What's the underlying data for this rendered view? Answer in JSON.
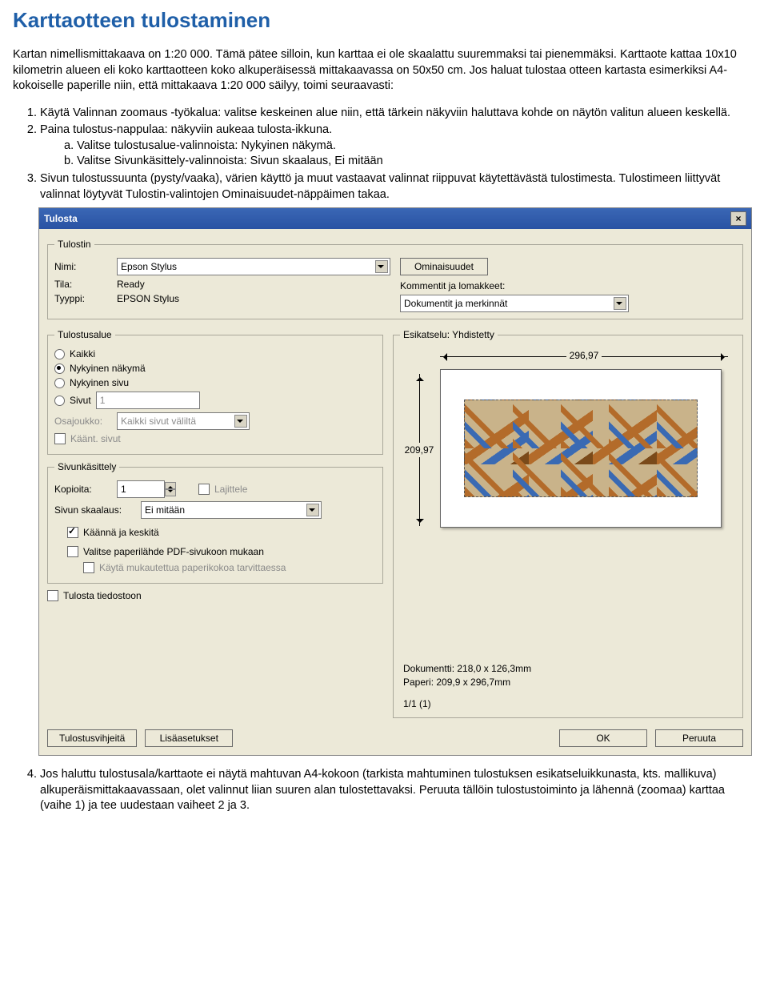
{
  "title": "Karttaotteen tulostaminen",
  "intro": "Kartan nimellismittakaava on 1:20 000. Tämä pätee silloin, kun karttaa ei ole skaalattu suuremmaksi tai pienemmäksi. Karttaote kattaa 10x10 kilometrin alueen eli koko karttaotteen koko alkuperäisessä mittakaavassa on 50x50 cm. Jos haluat tulostaa otteen kartasta esimerkiksi A4-kokoiselle paperille niin, että mittakaava 1:20 000 säilyy, toimi seuraavasti:",
  "steps": {
    "s1": "Käytä Valinnan zoomaus -työkalua: valitse keskeinen alue niin, että tärkein näkyviin haluttava kohde on näytön valitun alueen keskellä.",
    "s2": "Paina tulostus-nappulaa: näkyviin aukeaa tulosta-ikkuna.",
    "s2a": "a.  Valitse tulostusalue-valinnoista: Nykyinen näkymä.",
    "s2b": "b.  Valitse Sivunkäsittely-valinnoista: Sivun skaalaus, Ei mitään",
    "s3": "Sivun tulostussuunta (pysty/vaaka), värien käyttö ja muut vastaavat valinnat riippuvat käytettävästä tulostimesta. Tulostimeen liittyvät valinnat löytyvät Tulostin-valintojen Ominaisuudet-näppäimen takaa."
  },
  "dialog": {
    "title": "Tulosta",
    "printer": {
      "legend": "Tulostin",
      "name_lbl": "Nimi:",
      "name_val": "Epson Stylus",
      "status_lbl": "Tila:",
      "status_val": "Ready",
      "type_lbl": "Tyyppi:",
      "type_val": "EPSON Stylus",
      "props_btn": "Ominaisuudet",
      "comments_lbl": "Kommentit ja lomakkeet:",
      "comments_val": "Dokumentit ja merkinnät"
    },
    "range": {
      "legend": "Tulostusalue",
      "r1": "Kaikki",
      "r2": "Nykyinen näkymä",
      "r3": "Nykyinen sivu",
      "r4": "Sivut",
      "r4_val": "1",
      "subset_lbl": "Osajoukko:",
      "subset_val": "Kaikki sivut väliltä",
      "reverse": "Käänt. sivut"
    },
    "pagehandling": {
      "legend": "Sivunkäsittely",
      "copies_lbl": "Kopioita:",
      "copies_val": "1",
      "collate": "Lajittele",
      "scaling_lbl": "Sivun skaalaus:",
      "scaling_val": "Ei mitään",
      "autorotate": "Käännä ja keskitä",
      "papersrc": "Valitse paperilähde PDF-sivukoon mukaan",
      "custompaper": "Käytä mukautettua paperikokoa tarvittaessa"
    },
    "tofile": "Tulosta tiedostoon",
    "preview": {
      "legend_prefix": "Esikatselu: ",
      "legend_val": "Yhdistetty",
      "width": "296,97",
      "height": "209,97",
      "docinfo": "Dokumentti: 218,0 x 126,3mm",
      "paperinfo": "Paperi: 209,9 x 296,7mm",
      "pageinfo": "1/1 (1)"
    },
    "footer": {
      "tips": "Tulostusvihjeitä",
      "advanced": "Lisäasetukset",
      "ok": "OK",
      "cancel": "Peruuta"
    }
  },
  "after": "Jos haluttu tulostusala/karttaote ei näytä mahtuvan A4-kokoon (tarkista mahtuminen tulostuksen esikatseluikkunasta, kts. mallikuva) alkuperäismittakaavassaan, olet valinnut liian suuren alan tulostettavaksi. Peruuta tällöin tulostustoiminto ja lähennä (zoomaa) karttaa (vaihe 1) ja tee uudestaan vaiheet 2 ja 3."
}
